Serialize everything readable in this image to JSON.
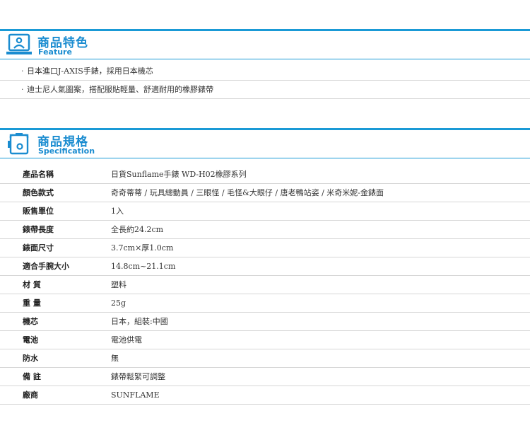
{
  "feature": {
    "title": "商品特色",
    "subtitle": "Feature",
    "icon": "monitor-person-icon",
    "items": [
      "日本進口J-AXIS手錶，採用日本機芯",
      "迪士尼人氣圖案，搭配服貼輕量、舒適耐用的橡膠錶帶"
    ]
  },
  "spec": {
    "title": "商品規格",
    "subtitle": "Specification",
    "icon": "device-frame-icon",
    "rows": [
      {
        "label": "產品名稱",
        "value": "日貨Sunflame手錶 WD-H02橡膠系列"
      },
      {
        "label": "顏色款式",
        "value": "奇奇蒂蒂 / 玩具總動員 / 三眼怪 / 毛怪&大眼仔 / 唐老鴨站姿 / 米奇米妮-金錶面"
      },
      {
        "label": "販售單位",
        "value": "1入"
      },
      {
        "label": "錶帶長度",
        "value": "全長約24.2cm"
      },
      {
        "label": "錶面尺寸",
        "value": "3.7cm×厚1.0cm"
      },
      {
        "label": "適合手腕大小",
        "value": "14.8cm~21.1cm"
      },
      {
        "label": "材 質",
        "value": "塑料"
      },
      {
        "label": "重 量",
        "value": "25g"
      },
      {
        "label": "機芯",
        "value": "日本，組裝:中國"
      },
      {
        "label": "電池",
        "value": "電池供電"
      },
      {
        "label": "防水",
        "value": "無"
      },
      {
        "label": "備 註",
        "value": "錶帶鬆緊可調整"
      },
      {
        "label": "廠商",
        "value": "SUNFLAME"
      }
    ]
  },
  "colors": {
    "accent": "#1a9ad6",
    "divider": "#d6d6d6"
  }
}
